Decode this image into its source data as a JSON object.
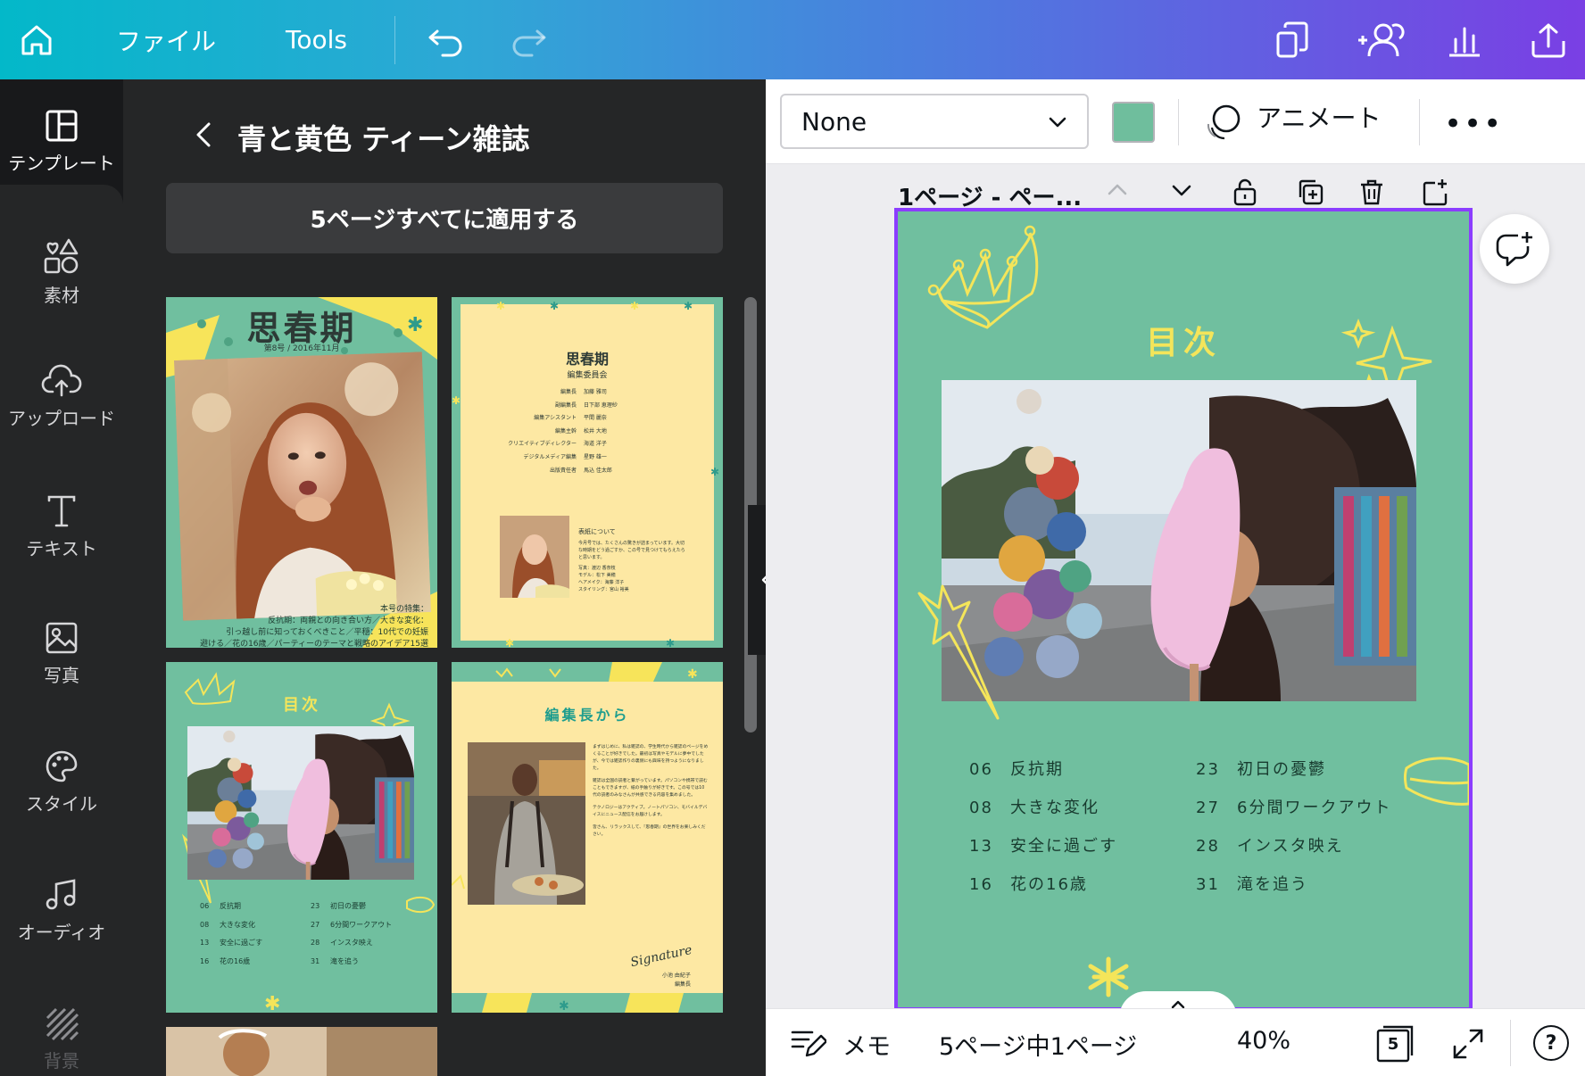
{
  "topbar": {
    "file_label": "ファイル",
    "tools_label": "Tools",
    "icons": [
      "home-icon",
      "undo-icon",
      "redo-icon",
      "resize-icon",
      "share-people-icon",
      "insights-icon",
      "share-upload-icon"
    ]
  },
  "rail": {
    "items": [
      {
        "label": "テンプレート",
        "icon": "template-icon"
      },
      {
        "label": "素材",
        "icon": "elements-icon"
      },
      {
        "label": "アップロード",
        "icon": "upload-icon"
      },
      {
        "label": "テキスト",
        "icon": "text-icon"
      },
      {
        "label": "写真",
        "icon": "photo-icon"
      },
      {
        "label": "スタイル",
        "icon": "palette-icon"
      },
      {
        "label": "オーディオ",
        "icon": "music-icon"
      },
      {
        "label": "背景",
        "icon": "background-icon"
      }
    ]
  },
  "panel": {
    "title": "青と黄色 ティーン雑誌",
    "apply_label": "5ページすべてに適用する",
    "thumb1": {
      "title": "思春期",
      "subtitle": "第8号 / 2016年11月",
      "caption1": "本号の特集：",
      "caption2": "反抗期：両親との向き合い方／大きな変化：",
      "caption3": "引っ越し前に知っておくべきこと／平穏：10代での妊娠",
      "caption4": "避ける／花の16歳／パーティーのテーマと戦略のアイデア15選"
    },
    "thumb2": {
      "title": "思春期",
      "subtitle": "編集委員会",
      "staff": [
        {
          "role": "編集長",
          "name": "加藤 雅司"
        },
        {
          "role": "副編集長",
          "name": "日下部 恵理紗"
        },
        {
          "role": "編集アシスタント",
          "name": "平間 麗奈"
        },
        {
          "role": "編集主幹",
          "name": "松井 大地"
        },
        {
          "role": "クリエイティブディレクター",
          "name": "海道 洋子"
        },
        {
          "role": "デジタルメディア編集",
          "name": "星野 雄一"
        },
        {
          "role": "出版責任者",
          "name": "馬込 佳太郎"
        }
      ],
      "cover_heading": "表紙について",
      "cover_text": "今月号では、たくさんの驚きが詰まっています。大切な時期をどう過ごすか、この号で見つけてもらえたらと思います。",
      "credits": [
        "写真：渡辺 香奈枝",
        "モデル：松下 美穂",
        "ヘアメイク：海藤 洋子",
        "スタイリング：宮山 裕美"
      ]
    },
    "thumb3": {
      "title": "目次"
    },
    "thumb4": {
      "title": "編集長から",
      "signature": "Signature",
      "sign_name": "小池 由紀子",
      "sign_role": "編集長",
      "body": [
        "まずはじめに、私は雑誌の、学生時代から雑誌のページをめくることが好きでした。最初は写真やモデルに夢中でしたが、今では雑誌作りの裏側にも興味を持つようになりました。",
        "雑誌は全国の読者と繋がっています。パソコンや携帯で読むこともできますが、紙の手触りが好きです。この号では10代の読者のみなさんが共感できる内容を集めました。",
        "テクノロジーはアクティブ。ノートパソコン、モバイルデバイスにニュース配信をお届けします。",
        "皆さん、リラックスして、『思春期』の世界をお楽しみください。"
      ]
    }
  },
  "editor": {
    "font_value": "None",
    "animate_label": "アニメート",
    "more_label": "•••",
    "page_title": "1ページ - ペー...",
    "bottom": {
      "notes_label": "メモ",
      "page_info": "5ページ中1ページ",
      "zoom": "40%",
      "page_count": "5",
      "help_label": "?"
    },
    "accent": "#8b3dff",
    "swatch_color": "#6fbe9d"
  },
  "canvas": {
    "title": "目次",
    "toc_left": [
      {
        "num": "06",
        "text": "反抗期"
      },
      {
        "num": "08",
        "text": "大きな変化"
      },
      {
        "num": "13",
        "text": "安全に過ごす"
      },
      {
        "num": "16",
        "text": "花の16歳"
      }
    ],
    "toc_right": [
      {
        "num": "23",
        "text": "初日の憂鬱"
      },
      {
        "num": "27",
        "text": "6分間ワークアウト"
      },
      {
        "num": "28",
        "text": "インスタ映え"
      },
      {
        "num": "31",
        "text": "滝を追う"
      }
    ],
    "bg_color": "#70bf9f",
    "title_color": "#f4e55a"
  }
}
